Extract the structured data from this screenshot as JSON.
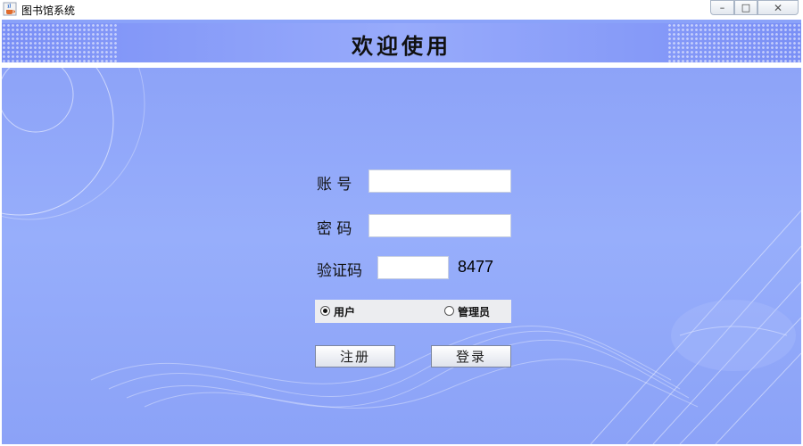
{
  "window": {
    "title": "图书馆系统",
    "controls": {
      "minimize": "–",
      "maximize": "□",
      "close": "✕"
    }
  },
  "header": {
    "title": "欢迎使用"
  },
  "form": {
    "account_label": "账 号",
    "account_value": "",
    "password_label": "密 码",
    "password_value": "",
    "captcha_label": "验证码",
    "captcha_value": "",
    "captcha_code": "8477",
    "roles": [
      {
        "label": "用户",
        "selected": true
      },
      {
        "label": "管理员",
        "selected": false
      }
    ],
    "register_label": "注册",
    "login_label": "登录"
  },
  "colors": {
    "background": "#8aa2f9",
    "header": "#7a8ff6",
    "panel": "#ecedf0"
  },
  "icons": {
    "app": "java-cup-icon"
  }
}
